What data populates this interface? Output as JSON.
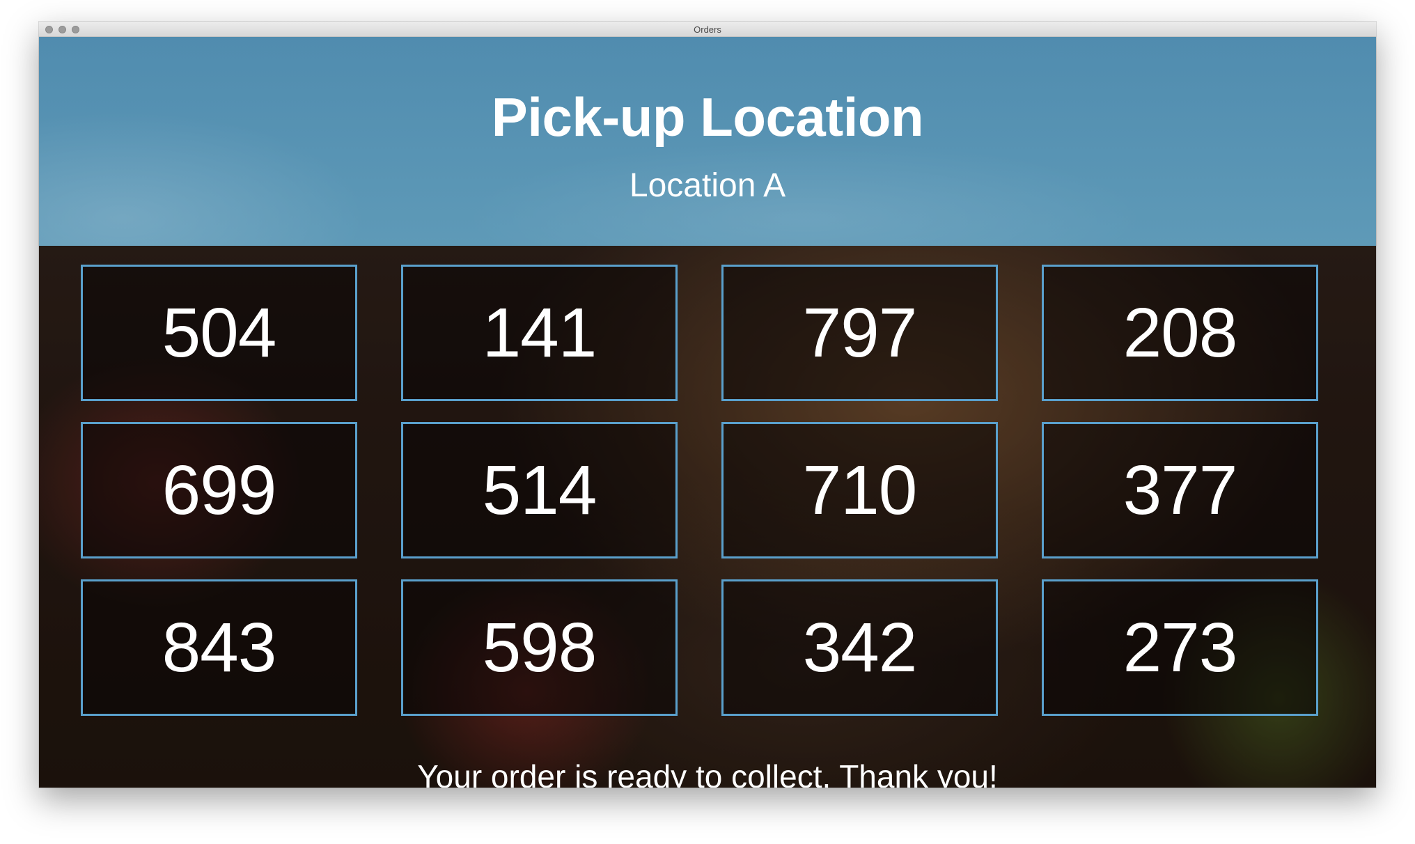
{
  "window": {
    "title": "Orders"
  },
  "header": {
    "title": "Pick-up Location",
    "location": "Location A",
    "color": "#5a96b4"
  },
  "orders": [
    "504",
    "141",
    "797",
    "208",
    "699",
    "514",
    "710",
    "377",
    "843",
    "598",
    "342",
    "273"
  ],
  "footer": {
    "message": "Your order is ready to collect. Thank you!"
  },
  "colors": {
    "card_border": "#5aa0cc",
    "text": "#ffffff"
  }
}
